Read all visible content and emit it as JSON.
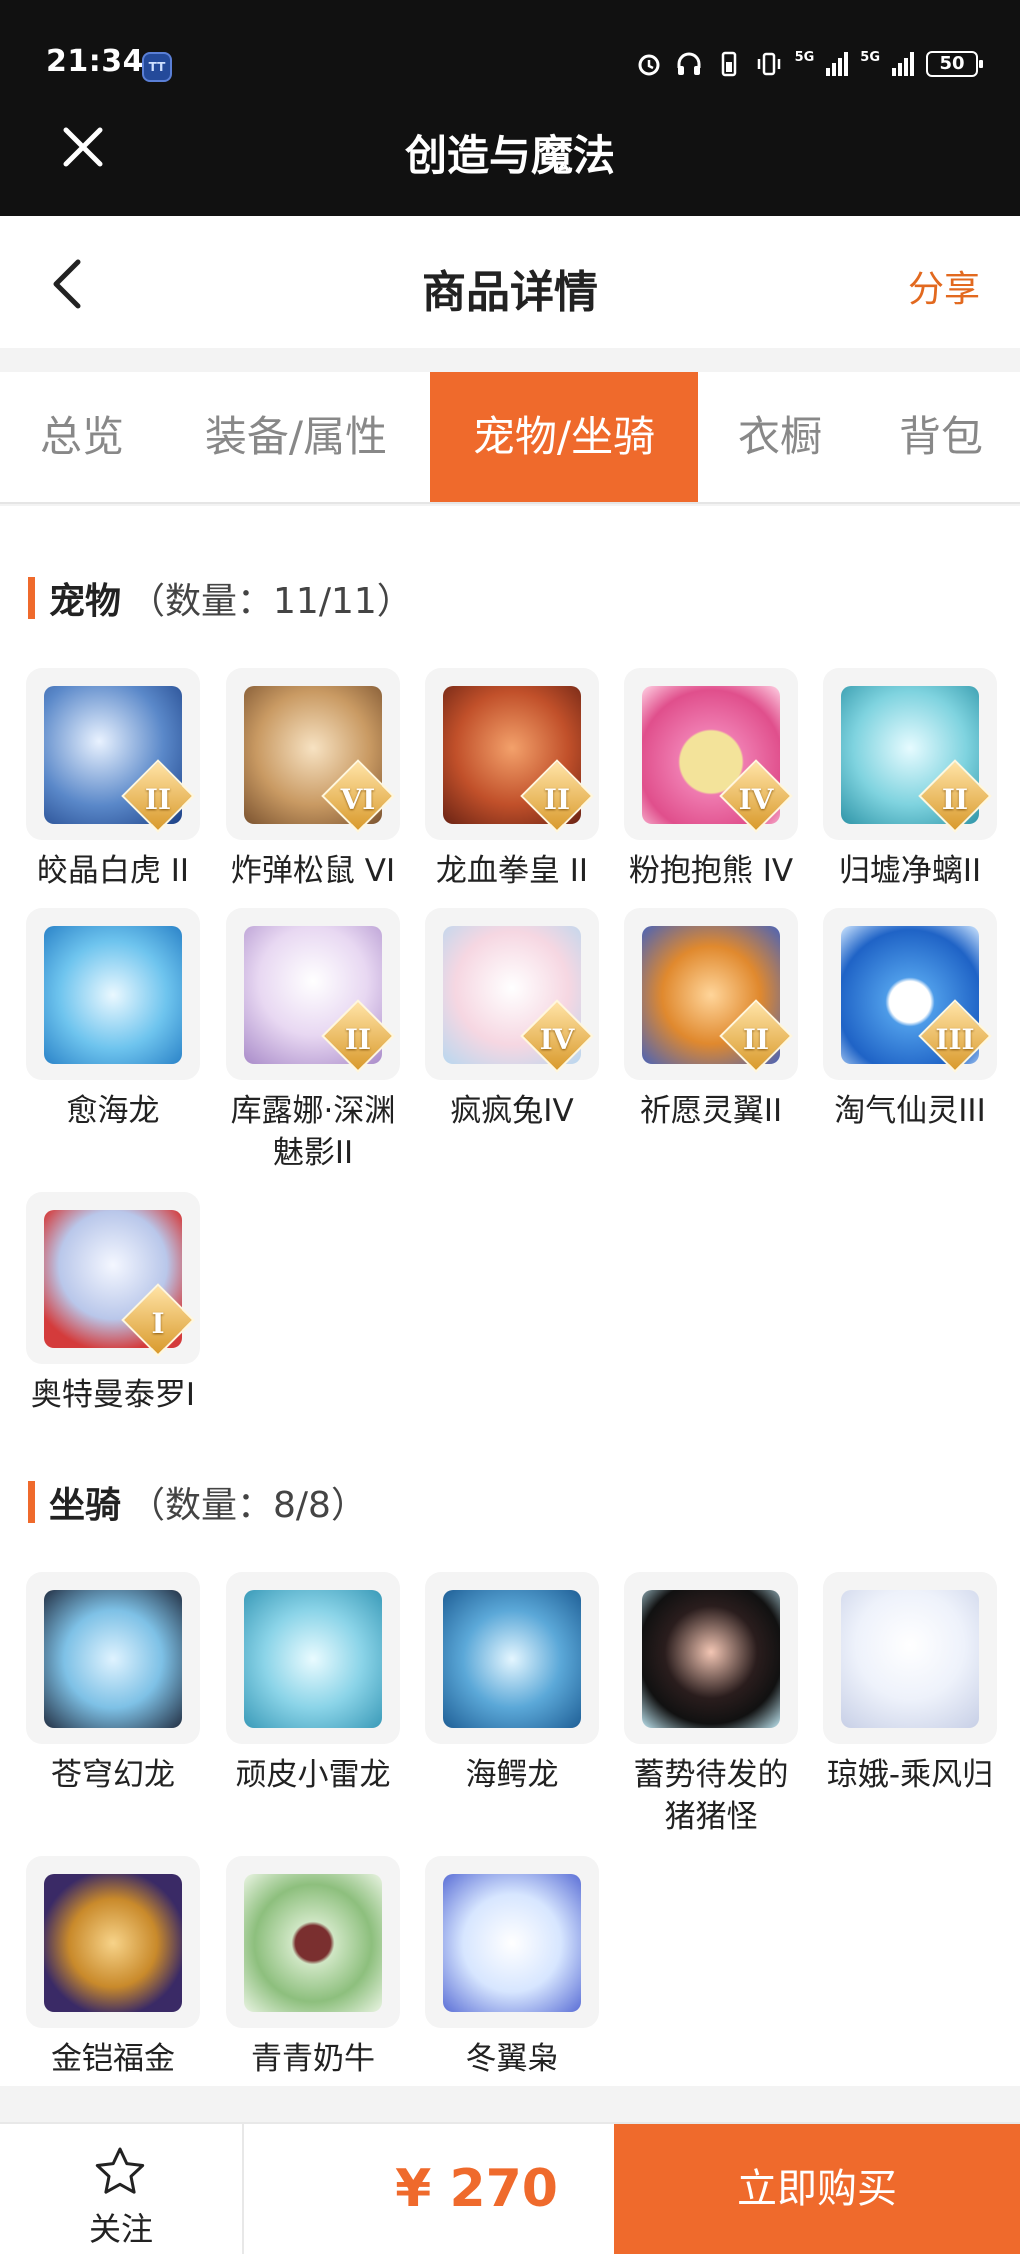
{
  "status_bar": {
    "time": "21:34",
    "app_badge": "TT",
    "network_1": "5G",
    "network_2": "5G",
    "battery": "50"
  },
  "top_bar": {
    "title": "创造与魔法"
  },
  "page_header": {
    "title": "商品详情",
    "share_label": "分享"
  },
  "tabs": [
    {
      "label": "总览"
    },
    {
      "label": "装备/属性"
    },
    {
      "label": "宠物/坐骑"
    },
    {
      "label": "衣橱"
    },
    {
      "label": "背包"
    }
  ],
  "pets": {
    "title": "宠物",
    "count": "（数量：11/11）",
    "items": [
      {
        "name": "皎晶白虎 II",
        "grade": "II"
      },
      {
        "name": "炸弹松鼠 VI",
        "grade": "VI"
      },
      {
        "name": "龙血拳皇 II",
        "grade": "II"
      },
      {
        "name": "粉抱抱熊 IV",
        "grade": "IV"
      },
      {
        "name": "归墟净螭II",
        "grade": "II"
      },
      {
        "name": "愈海龙",
        "grade": ""
      },
      {
        "name": "库露娜·深渊魅影II",
        "grade": "II"
      },
      {
        "name": "疯疯兔IV",
        "grade": "IV"
      },
      {
        "name": "祈愿灵翼II",
        "grade": "II"
      },
      {
        "name": "淘气仙灵III",
        "grade": "III"
      },
      {
        "name": "奥特曼泰罗I",
        "grade": "I"
      }
    ]
  },
  "mounts": {
    "title": "坐骑",
    "count": "（数量：8/8）",
    "items": [
      {
        "name": "苍穹幻龙"
      },
      {
        "name": "顽皮小雷龙"
      },
      {
        "name": "海鳄龙"
      },
      {
        "name": "蓄势待发的猪猪怪"
      },
      {
        "name": "琼娥-乘风归"
      },
      {
        "name": "金铠福金"
      },
      {
        "name": "青青奶牛"
      },
      {
        "name": "冬翼枭"
      }
    ]
  },
  "bottom_bar": {
    "follow_label": "关注",
    "price": "¥ 270",
    "buy_label": "立即购买"
  },
  "colors": {
    "accent": "#ef6a2c",
    "topbar": "#111111"
  }
}
